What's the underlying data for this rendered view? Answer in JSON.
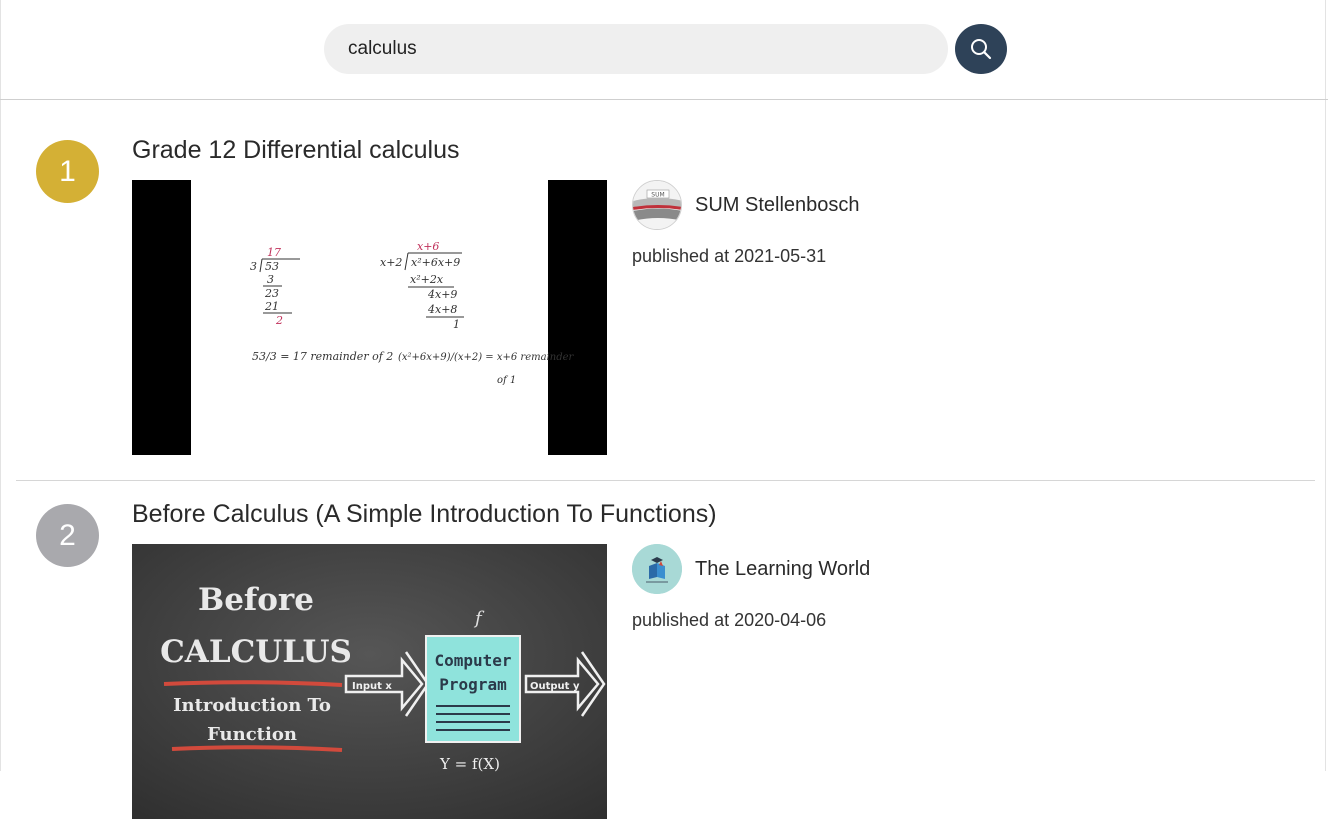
{
  "search": {
    "query": "calculus",
    "button_icon": "search-icon"
  },
  "results": [
    {
      "rank": "1",
      "rank_color": "#d4b035",
      "title": "Grade 12 Differential calculus",
      "channel": "SUM Stellenbosch",
      "channel_avatar_text": "SUM",
      "published": "published at 2021-05-31",
      "thumbnail_text": {
        "top_left": "17",
        "divisor": "3",
        "dividend": "53",
        "step1": "3",
        "step2": "23",
        "step3": "21",
        "remainder": "2",
        "left_caption": "53/3 = 17 remainder of 2",
        "quotient_right": "x+6",
        "divisor_right": "x+2",
        "dividend_right": "x²+6x+9",
        "r_step1": "x²+2x",
        "r_step2": "4x+9",
        "r_step3": "4x+8",
        "r_remainder": "1",
        "right_caption_a": "(x²+6x+9)/(x+2) = x+6 remainder",
        "right_caption_b": "of 1"
      }
    },
    {
      "rank": "2",
      "rank_color": "#a9a9ad",
      "title": "Before Calculus (A Simple Introduction To Functions)",
      "channel": "The Learning World",
      "published": "published at 2020-04-06",
      "thumbnail_text": {
        "line1": "Before",
        "line2": "CALCULUS",
        "line3": "Introduction To",
        "line4": "Function",
        "box_line1": "Computer",
        "box_line2": "Program",
        "input_label": "Input x",
        "output_label": "Output y",
        "f_label": "f",
        "formula": "Y = f(X)"
      }
    }
  ],
  "colors": {
    "search_button": "#2e4258",
    "search_field": "#efefef",
    "rank1": "#d4b035",
    "rank2": "#a9a9ad"
  }
}
